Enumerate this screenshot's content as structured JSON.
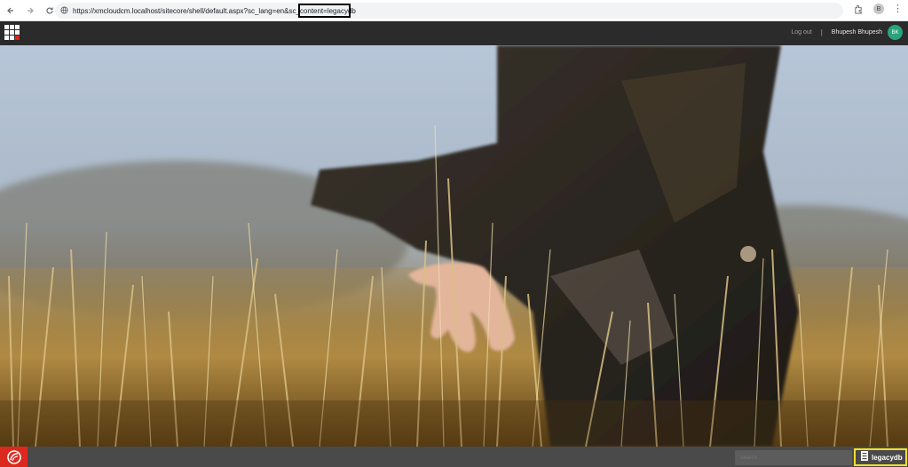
{
  "browser": {
    "url": "https://xmcloudcm.localhost/sitecore/shell/default.aspx?sc_lang=en&sc_content=legacydb",
    "profile_initial": "B"
  },
  "header": {
    "logout_label": "Log out",
    "separator": "|",
    "username": "Bhupesh Bhupesh",
    "avatar_initials": "BK"
  },
  "footer": {
    "search_placeholder": "Search",
    "database_label": "legacydb"
  },
  "colors": {
    "header_bg": "#2b2b2b",
    "avatar": "#2aa37d",
    "sitecore_red": "#dc291e",
    "highlight_yellow": "#f1e02a"
  },
  "icons": {
    "back": "arrow-left-icon",
    "forward": "arrow-right-icon",
    "reload": "reload-icon",
    "site_info": "site-info-icon",
    "extensions": "puzzle-icon",
    "menu": "kebab-menu-icon",
    "launchpad": "launchpad-grid-icon",
    "sitecore": "sitecore-logo",
    "database": "database-icon"
  }
}
